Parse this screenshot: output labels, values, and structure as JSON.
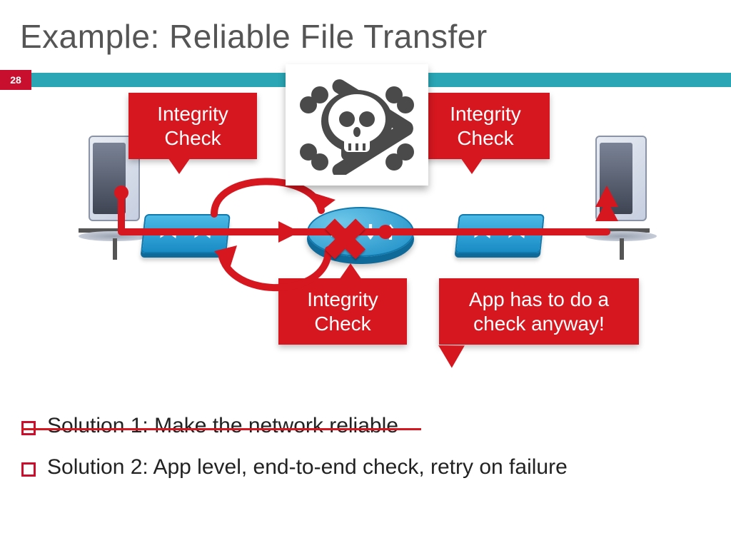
{
  "slide": {
    "title": "Example: Reliable File Transfer",
    "page_number": "28"
  },
  "callouts": {
    "integrity1": "Integrity Check",
    "integrity2": "Integrity Check",
    "integrity3": "Integrity Check",
    "app_check": "App has to do a check anyway!"
  },
  "icons": {
    "skull": "skull-crossbones"
  },
  "bullets": {
    "b1": "Solution 1: Make the network reliable",
    "b2": "Solution 2: App level, end-to-end check, retry on failure"
  }
}
